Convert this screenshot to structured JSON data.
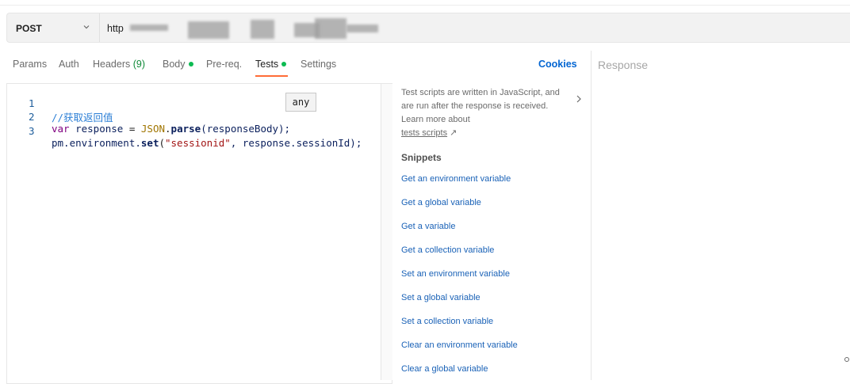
{
  "request": {
    "method": "POST",
    "url_prefix": "http"
  },
  "tabs": [
    {
      "label": "Params"
    },
    {
      "label": "Auth"
    },
    {
      "label": "Headers",
      "count": "(9)"
    },
    {
      "label": "Body"
    },
    {
      "label": "Pre-req."
    },
    {
      "label": "Tests"
    },
    {
      "label": "Settings"
    }
  ],
  "cookies_label": "Cookies",
  "response_label": "Response",
  "editor": {
    "line_numbers": [
      "1",
      "2",
      "3"
    ],
    "line1": {
      "comment": "//获取返回值"
    },
    "line2": {
      "kw": "var",
      "name": " response ",
      "eq": "= ",
      "cls": "JSON",
      "dot": ".",
      "fn": "parse",
      "rest": "(responseBody);"
    },
    "line3": {
      "a": "pm.environment.",
      "fn": "set",
      "b": "(",
      "str": "\"sessionid\"",
      "c": ", response.sessionId);"
    },
    "tooltip": "any"
  },
  "help": {
    "text": "Test scripts are written in JavaScript, and are run after the response is received. Learn more about",
    "link": "tests scripts",
    "link_arrow": "↗"
  },
  "snippets": {
    "title": "Snippets",
    "items": [
      "Get an environment variable",
      "Get a global variable",
      "Get a variable",
      "Get a collection variable",
      "Set an environment variable",
      "Set a global variable",
      "Set a collection variable",
      "Clear an environment variable",
      "Clear a global variable"
    ]
  },
  "colors": {
    "accent": "#ff6c37",
    "link": "#0265d2",
    "status_dot": "#0cbb52"
  }
}
